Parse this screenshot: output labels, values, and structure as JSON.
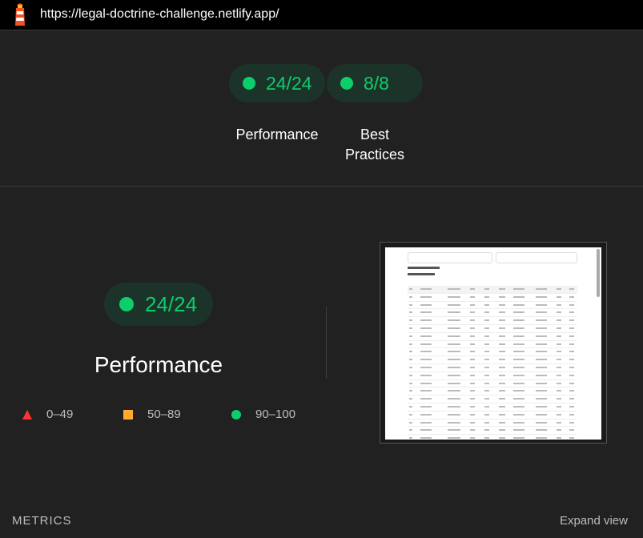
{
  "browser": {
    "url": "https://legal-doctrine-challenge.netlify.app/"
  },
  "summary": {
    "performance": {
      "score": "24/24",
      "label": "Performance"
    },
    "best_practices": {
      "score": "8/8",
      "label_line1": "Best",
      "label_line2": "Practices"
    }
  },
  "category": {
    "score": "24/24",
    "title": "Performance"
  },
  "legend": {
    "fail": "0–49",
    "average": "50–89",
    "pass": "90–100"
  },
  "colors": {
    "pass": "#0cce6b",
    "average": "#ffaa33",
    "fail": "#ff3333",
    "pass_bg": "#1b3329",
    "background": "#212121"
  },
  "footer": {
    "metrics_label": "METRICS",
    "expand_label": "Expand view"
  }
}
